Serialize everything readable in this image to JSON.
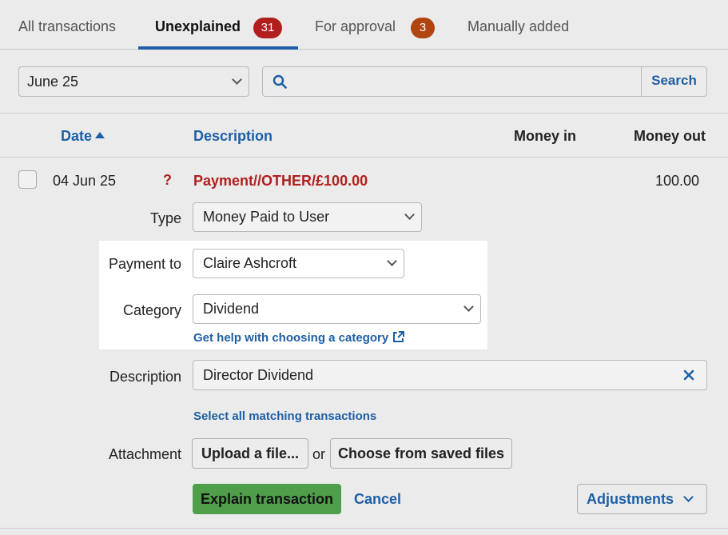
{
  "tabs": [
    {
      "label": "All transactions"
    },
    {
      "label": "Unexplained",
      "badge": "31",
      "active": true
    },
    {
      "label": "For approval",
      "badge": "3"
    },
    {
      "label": "Manually added"
    }
  ],
  "filter": {
    "month": "June 25",
    "search_value": "",
    "search_button": "Search"
  },
  "columns": {
    "date": "Date",
    "description": "Description",
    "money_in": "Money in",
    "money_out": "Money out"
  },
  "transaction": {
    "date": "04 Jun 25",
    "status_marker": "?",
    "description": "Payment//OTHER/£100.00",
    "money_in": "",
    "money_out": "100.00"
  },
  "form": {
    "type_label": "Type",
    "type_value": "Money Paid to User",
    "payment_to_label": "Payment to",
    "payment_to_value": "Claire Ashcroft",
    "category_label": "Category",
    "category_value": "Dividend",
    "help_link": "Get help with choosing a category",
    "description_label": "Description",
    "description_value": "Director Dividend",
    "select_matching_link": "Select all matching transactions",
    "attachment_label": "Attachment",
    "upload_button": "Upload a file...",
    "or_text": "or",
    "choose_saved_button": "Choose from saved files",
    "explain_button": "Explain transaction",
    "cancel_link": "Cancel",
    "adjustments_button": "Adjustments"
  },
  "colors": {
    "link_blue": "#1d5fa6",
    "badge_red": "#b21e1e",
    "badge_orange": "#b04510",
    "error_red": "#b21e1e",
    "primary_green": "#4e9e4a"
  }
}
